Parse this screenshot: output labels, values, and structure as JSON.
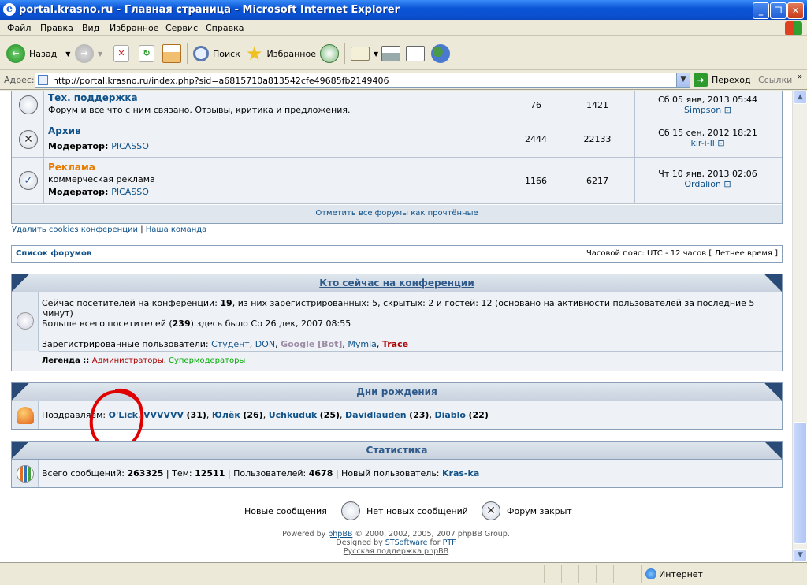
{
  "window": {
    "title": "portal.krasno.ru - Главная страница - Microsoft Internet Explorer"
  },
  "menu": [
    "Файл",
    "Правка",
    "Вид",
    "Избранное",
    "Сервис",
    "Справка"
  ],
  "toolbar": {
    "back": "Назад",
    "search": "Поиск",
    "favorites": "Избранное"
  },
  "address": {
    "label": "Адрес:",
    "url": "http://portal.krasno.ru/index.php?sid=a6815710a813542cfe49685fb2149406",
    "go": "Переход",
    "links": "Ссылки"
  },
  "forums": [
    {
      "title": "Тех. поддержка",
      "desc": "Форум и все что с ним связано. Отзывы, критика и предложения.",
      "moderator_label": "",
      "moderator": "",
      "topics": "76",
      "posts": "1421",
      "last_date": "Сб 05 янв, 2013 05:44",
      "last_user": "Simpson",
      "status": "new-none"
    },
    {
      "title": "Архив",
      "desc": "",
      "moderator_label": "Модератор:",
      "moderator": "PICASSO",
      "topics": "2444",
      "posts": "22133",
      "last_date": "Сб 15 сен, 2012 18:21",
      "last_user": "kir-i-ll",
      "status": "locked"
    },
    {
      "title": "Реклама",
      "desc": "коммерческая реклама",
      "moderator_label": "Модератор:",
      "moderator": "PICASSO",
      "topics": "1166",
      "posts": "6217",
      "last_date": "Чт 10 янв, 2013 02:06",
      "last_user": "Ordalion",
      "status": "read"
    }
  ],
  "mark_read": "Отметить все форумы как прочтённые",
  "links_row": {
    "delete_cookies": "Удалить cookies конференции",
    "sep": "|",
    "team": "Наша команда"
  },
  "navbar": {
    "forum_list": "Список форумов",
    "timezone": "Часовой пояс: UTC - 12 часов [ Летнее время ]"
  },
  "online": {
    "heading": "Кто сейчас на конференции",
    "line1_a": "Сейчас посетителей на конференции: ",
    "line1_b": "19",
    "line1_c": ", из них зарегистрированных: 5, скрытых: 2 и гостей: 12 (основано на активности пользователей за последние 5",
    "line1_d": "минут)",
    "line2_a": "Больше всего посетителей (",
    "line2_b": "239",
    "line2_c": ") здесь было Ср 26 дек, 2007 08:55",
    "reg_label": "Зарегистрированные пользователи: ",
    "users": [
      "Студент",
      "DON",
      "Google [Bot]",
      "Mymla",
      "Trace"
    ],
    "legend_label": "Легенда :: ",
    "legend_admins": "Администраторы",
    "legend_supermods": "Супермодераторы",
    "colors": {
      "admin": "#aa0000",
      "supermod": "#00aa00",
      "bot": "#9e8da7"
    }
  },
  "birthdays": {
    "heading": "Дни рождения",
    "label": "Поздравляем: ",
    "people": [
      {
        "name": "O'Lick",
        "age": ""
      },
      {
        "name": "VVVVVV",
        "age": "(31)"
      },
      {
        "name": "Юлёк",
        "age": "(26)"
      },
      {
        "name": "Uchkuduk",
        "age": "(25)"
      },
      {
        "name": "Davidlauden",
        "age": "(23)"
      },
      {
        "name": "Diablo",
        "age": "(22)"
      }
    ]
  },
  "stats": {
    "heading": "Статистика",
    "posts_label": "Всего сообщений: ",
    "posts": "263325",
    "topics_label": " | Тем: ",
    "topics": "12511",
    "users_label": " | Пользователей: ",
    "users": "4678",
    "newest_label": " | Новый пользователь: ",
    "newest": "Kras-ka"
  },
  "legend_icons": {
    "new": "Новые сообщения",
    "none": "Нет новых сообщений",
    "locked": "Форум закрыт"
  },
  "footer": {
    "powered_a": "Powered by ",
    "phpbb": "phpBB",
    "powered_b": " © 2000, 2002, 2005, 2007 phpBB Group.",
    "designed_a": "Designed by ",
    "sts": "STSoftware",
    "designed_b": " for ",
    "ptf": "PTF",
    "ru": "Русская поддержка phpBB"
  },
  "status": {
    "zone": "Интернет"
  },
  "annotation_color": "#e00000"
}
